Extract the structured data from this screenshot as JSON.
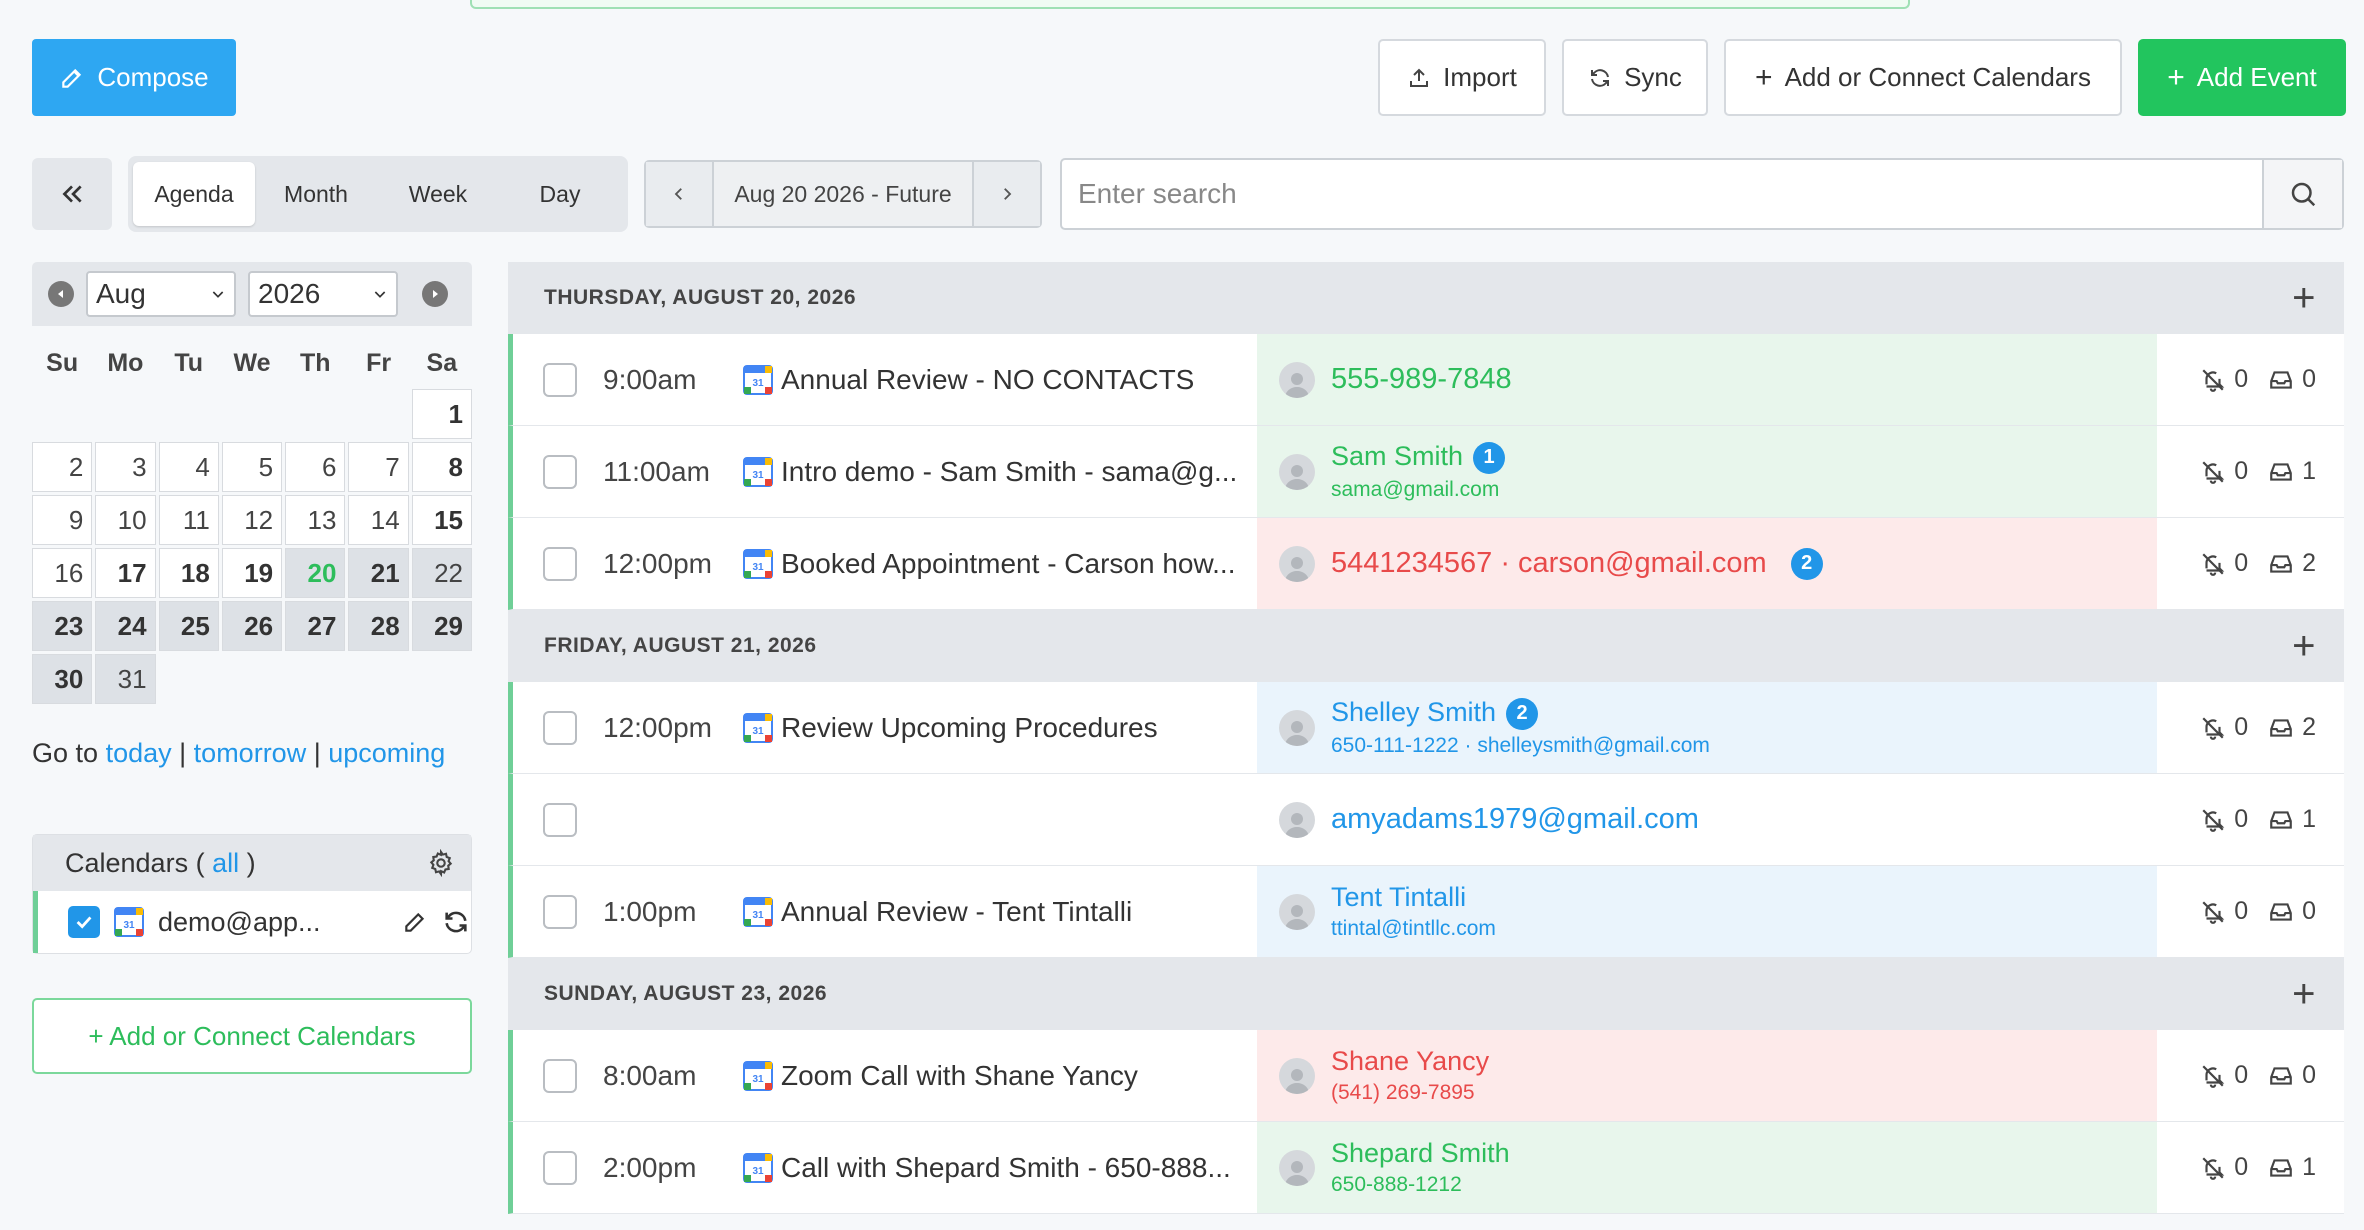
{
  "toolbar": {
    "compose_label": "Compose",
    "import_label": "Import",
    "sync_label": "Sync",
    "add_connect_label": "Add or Connect Calendars",
    "add_event_label": "Add Event"
  },
  "views": {
    "tabs": [
      "Agenda",
      "Month",
      "Week",
      "Day"
    ],
    "active": "Agenda",
    "date_range": "Aug 20 2026 - Future"
  },
  "search": {
    "placeholder": "Enter search"
  },
  "minical": {
    "month": "Aug",
    "year": "2026",
    "weekdays": [
      "Su",
      "Mo",
      "Tu",
      "We",
      "Th",
      "Fr",
      "Sa"
    ],
    "days": [
      {
        "d": "",
        "cls": "empty"
      },
      {
        "d": "",
        "cls": "empty"
      },
      {
        "d": "",
        "cls": "empty"
      },
      {
        "d": "",
        "cls": "empty"
      },
      {
        "d": "",
        "cls": "empty"
      },
      {
        "d": "",
        "cls": "empty"
      },
      {
        "d": "1",
        "cls": "past bold"
      },
      {
        "d": "2",
        "cls": "past"
      },
      {
        "d": "3",
        "cls": "past"
      },
      {
        "d": "4",
        "cls": "past"
      },
      {
        "d": "5",
        "cls": "past"
      },
      {
        "d": "6",
        "cls": "past"
      },
      {
        "d": "7",
        "cls": "past"
      },
      {
        "d": "8",
        "cls": "past bold"
      },
      {
        "d": "9",
        "cls": "past"
      },
      {
        "d": "10",
        "cls": "past"
      },
      {
        "d": "11",
        "cls": "past"
      },
      {
        "d": "12",
        "cls": "past"
      },
      {
        "d": "13",
        "cls": "past"
      },
      {
        "d": "14",
        "cls": "past"
      },
      {
        "d": "15",
        "cls": "past bold"
      },
      {
        "d": "16",
        "cls": "past"
      },
      {
        "d": "17",
        "cls": "past bold"
      },
      {
        "d": "18",
        "cls": "past bold"
      },
      {
        "d": "19",
        "cls": "past bold"
      },
      {
        "d": "20",
        "cls": "future today"
      },
      {
        "d": "21",
        "cls": "future bold"
      },
      {
        "d": "22",
        "cls": "future"
      },
      {
        "d": "23",
        "cls": "future bold"
      },
      {
        "d": "24",
        "cls": "future bold"
      },
      {
        "d": "25",
        "cls": "future bold"
      },
      {
        "d": "26",
        "cls": "future bold"
      },
      {
        "d": "27",
        "cls": "future bold"
      },
      {
        "d": "28",
        "cls": "future bold"
      },
      {
        "d": "29",
        "cls": "future bold"
      },
      {
        "d": "30",
        "cls": "future bold"
      },
      {
        "d": "31",
        "cls": "future"
      }
    ]
  },
  "goto": {
    "prefix": "Go to",
    "today": "today",
    "tomorrow": "tomorrow",
    "upcoming": "upcoming",
    "sep": "|"
  },
  "calendars": {
    "heading": "Calendars (",
    "all_link": "all",
    "heading_end": ")",
    "items": [
      {
        "name": "demo@app...",
        "checked": true
      }
    ],
    "add_label": "+ Add or Connect Calendars"
  },
  "agenda": [
    {
      "date": "THURSDAY, AUGUST 20, 2026",
      "events": [
        {
          "time": "9:00am",
          "title": "Annual Review - NO CONTACTS",
          "tone": "green",
          "single": "555-989-7848",
          "badge": "",
          "notify": "0",
          "msg": "0"
        },
        {
          "time": "11:00am",
          "title": "Intro demo - Sam Smith - sama@g...",
          "tone": "green",
          "name": "Sam Smith",
          "sub": "sama@gmail.com",
          "badge": "1",
          "notify": "0",
          "msg": "1"
        },
        {
          "time": "12:00pm",
          "title": "Booked Appointment - Carson how...",
          "tone": "red",
          "single": "5441234567 · carson@gmail.com",
          "badge": "2",
          "notify": "0",
          "msg": "2"
        }
      ]
    },
    {
      "date": "FRIDAY, AUGUST 21, 2026",
      "events": [
        {
          "time": "12:00pm",
          "title": "Review Upcoming Procedures",
          "tone": "blue",
          "name": "Shelley Smith",
          "sub": "650-111-1222 · shelleysmith@gmail.com",
          "badge": "2",
          "notify": "0",
          "msg": "2"
        },
        {
          "time": "",
          "title": "",
          "tone": "white",
          "single": "amyadams1979@gmail.com",
          "badge": "",
          "notify": "0",
          "msg": "1",
          "noicon": true
        },
        {
          "time": "1:00pm",
          "title": "Annual Review - Tent Tintalli",
          "tone": "blue",
          "name": "Tent Tintalli",
          "sub": "ttintal@tintllc.com",
          "badge": "",
          "notify": "0",
          "msg": "0"
        }
      ]
    },
    {
      "date": "SUNDAY, AUGUST 23, 2026",
      "events": [
        {
          "time": "8:00am",
          "title": "Zoom Call with Shane Yancy",
          "tone": "red",
          "name": "Shane Yancy",
          "sub": "(541) 269-7895",
          "badge": "",
          "notify": "0",
          "msg": "0"
        },
        {
          "time": "2:00pm",
          "title": "Call with Shepard Smith - 650-888...",
          "tone": "green",
          "name": "Shepard Smith",
          "sub": "650-888-1212",
          "badge": "",
          "notify": "0",
          "msg": "1"
        }
      ]
    }
  ]
}
